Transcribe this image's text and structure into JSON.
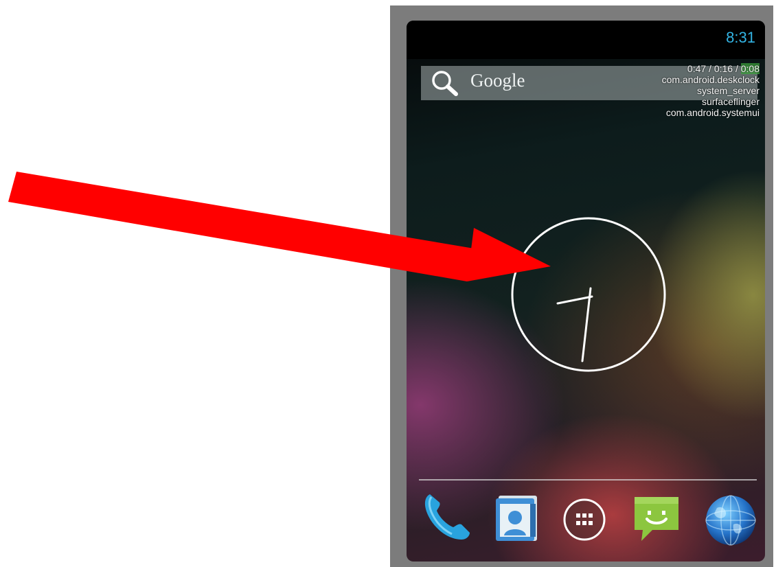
{
  "status_bar": {
    "time": "8:31"
  },
  "search": {
    "label": "Google"
  },
  "overlay": {
    "cpu_load_part1": "0:47 / 0:16 /",
    "cpu_load_part2": "0:08",
    "processes": [
      "com.android.deskclock",
      "system_server",
      "surfaceflinger",
      "com.android.systemui"
    ]
  },
  "dock": {
    "icons": [
      "phone-icon",
      "contacts-icon",
      "all-apps-icon",
      "messaging-icon",
      "browser-icon"
    ]
  },
  "colors": {
    "accent_blue": "#33b5e5",
    "annotation_arrow": "#ff0000",
    "device_frame": "#7c7c7c"
  }
}
